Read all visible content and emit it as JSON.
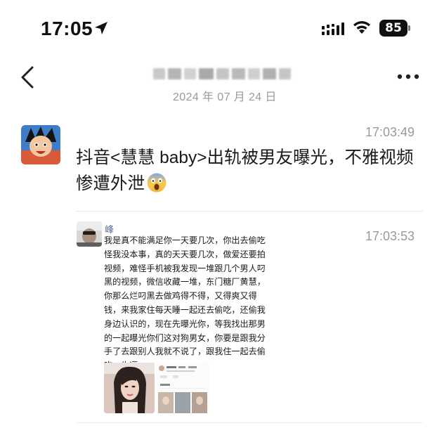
{
  "status_bar": {
    "time": "17:05",
    "battery_level": "85",
    "icons": [
      "location-arrow-icon",
      "cellular-signal-icon",
      "wifi-icon",
      "battery-icon"
    ]
  },
  "header": {
    "title_redacted": true,
    "date": "2024 年 07 月 24 日",
    "icons": [
      "back-chevron-icon",
      "more-icon"
    ]
  },
  "messages": [
    {
      "time": "17:03:49",
      "text": "抖音<慧慧 baby>出轨被男友曝光，不雅视频惨遭外泄",
      "emoji": "screaming-face-emoji"
    },
    {
      "sender": "峰",
      "time": "17:03:53",
      "text": "我是真不能满足你一天要几次，你出去偷吃怪我没本事，真的天天要几次，做爱还要拍视频，难怪手机被我发现一堆跟几个男人叼黑的视频，微信收藏一堆，东门糖厂黄慧，你那么烂叼黑去做鸡得不得，又得爽又得钱，来我家住每天睡一起还去偷吃，还偷我身边认识的，现在先曝光你，等我找出那男的一起曝光你们这对狗男女，你要是跟我分手了去跟别人我就不说了，跟我住一起去偷吃，牛逼",
      "attachments": [
        "photo-woman-selfie",
        "photo-profile-screenshot"
      ]
    }
  ],
  "colors": {
    "sender_name": "#576b95",
    "timestamp": "#9a9a9a",
    "divider": "#e6e6e6"
  }
}
